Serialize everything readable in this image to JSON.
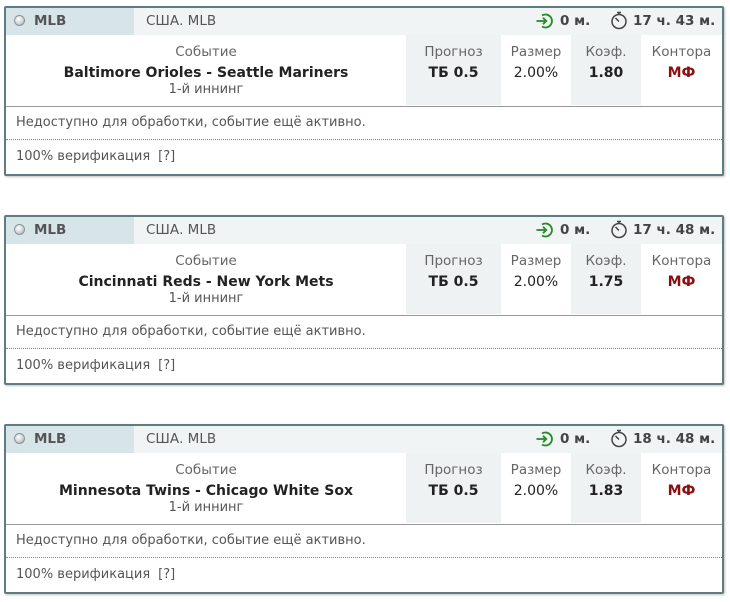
{
  "labels": {
    "event": "Событие",
    "forecast": "Прогноз",
    "size": "Размер",
    "coef": "Коэф.",
    "bookie": "Контора",
    "note": "Недоступно для обработки, событие ещё активно.",
    "verification": "100% верификация",
    "help": "[?]"
  },
  "bets": [
    {
      "league": "MLB",
      "region": "США. MLB",
      "go_time": "0 м.",
      "timer": "17 ч. 43 м.",
      "teams": "Baltimore Orioles - Seattle Mariners",
      "period": "1-й иннинг",
      "forecast": "ТБ 0.5",
      "size": "2.00%",
      "coef": "1.80",
      "bookie": "МФ"
    },
    {
      "league": "MLB",
      "region": "США. MLB",
      "go_time": "0 м.",
      "timer": "17 ч. 48 м.",
      "teams": "Cincinnati Reds - New York Mets",
      "period": "1-й иннинг",
      "forecast": "ТБ 0.5",
      "size": "2.00%",
      "coef": "1.75",
      "bookie": "МФ"
    },
    {
      "league": "MLB",
      "region": "США. MLB",
      "go_time": "0 м.",
      "timer": "18 ч. 48 м.",
      "teams": "Minnesota Twins - Chicago White Sox",
      "period": "1-й иннинг",
      "forecast": "ТБ 0.5",
      "size": "2.00%",
      "coef": "1.83",
      "bookie": "МФ"
    }
  ],
  "colors": {
    "border": "#5e7d82",
    "header_league_bg": "#d8e5e8",
    "go_icon": "#2a8a2a",
    "bookie": "#8a1010"
  },
  "icons": {
    "status": "status-dot-icon",
    "go": "arrow-enter-icon",
    "timer": "stopwatch-icon"
  }
}
